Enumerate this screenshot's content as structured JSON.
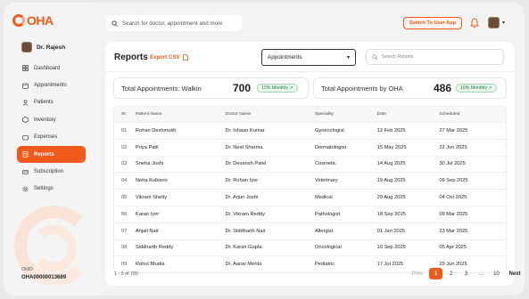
{
  "brand": {
    "logo_text": "OHA"
  },
  "user": {
    "name": "Dr. Rajesh"
  },
  "sidebar": {
    "items": [
      {
        "label": "Dashboard",
        "icon": "dashboard-icon"
      },
      {
        "label": "Appointments",
        "icon": "calendar-icon"
      },
      {
        "label": "Patients",
        "icon": "patients-icon"
      },
      {
        "label": "Inventory",
        "icon": "inventory-icon"
      },
      {
        "label": "Expenses",
        "icon": "wallet-icon"
      },
      {
        "label": "Reports",
        "icon": "reports-icon",
        "active": true
      },
      {
        "label": "Subscription",
        "icon": "subscription-icon"
      },
      {
        "label": "Settings",
        "icon": "gear-icon"
      }
    ],
    "ohid_label": "OHID",
    "ohid_value": "OHA00000013689"
  },
  "topbar": {
    "search_placeholder": "Search for doctor, appointment and more",
    "switch_label": "Switch To User App"
  },
  "page": {
    "title": "Reports",
    "export_label": "Export CSV",
    "select_value": "Appointments",
    "search_placeholder": "Search Reports"
  },
  "stats": [
    {
      "label": "Total Appointments: Walkin",
      "value": "700",
      "badge": "10% Monthly"
    },
    {
      "label": "Total Appointments by OHA",
      "value": "486",
      "badge": "10% Monthly"
    }
  ],
  "table": {
    "headers": [
      "Sr.",
      "Patient Name",
      "Doctor Name",
      "Speciality",
      "Date",
      "Scheduled"
    ],
    "rows": [
      [
        "01",
        "Rohan Deshmukh",
        "Dr. Ishaan Kumar",
        "Gynecologist",
        "12 Feb 2025",
        "27 Mar 2025"
      ],
      [
        "02",
        "Priya Patil",
        "Dr. Neel Sharma",
        "Dermatologist",
        "15 May 2025",
        "22 Jun 2025"
      ],
      [
        "03",
        "Sneha Joshi",
        "Dr. Devansh Patel",
        "Cosmetic",
        "14 Aug 2025",
        "30 Jul 2025"
      ],
      [
        "04",
        "Neha Kulkarni",
        "Dr. Rohan Iyer",
        "Veterinary",
        "19 Aug 2025",
        "09 Sep 2025"
      ],
      [
        "05",
        "Vikram Shetty",
        "Dr. Arjun Joshi",
        "Medical",
        "29 Aug 2025",
        "04 Oct 2025"
      ],
      [
        "06",
        "Karan Iyer",
        "Dr. Vikram Reddy",
        "Pathologist",
        "18 Sep 2025",
        "09 Mar 2025"
      ],
      [
        "07",
        "Anjali Nair",
        "Dr. Siddharth Nair",
        "Allergist",
        "01 Jan 2025",
        "23 Mar 2025"
      ],
      [
        "08",
        "Siddharth Reddy",
        "Dr. Karan Gupta",
        "Oncological",
        "10 Sep 2025",
        "05 Apr 2025"
      ],
      [
        "09",
        "Rahul Bhatia",
        "Dr. Aarav Mehta",
        "Pediatric",
        "17 Jul 2025",
        "29 Jun 2025"
      ]
    ]
  },
  "pagination": {
    "info": "1 - 9 of 700",
    "prev": "Prev",
    "pages": [
      "1",
      "2",
      "3",
      "...",
      "10"
    ],
    "current": "1",
    "next": "Next"
  },
  "colors": {
    "accent": "#f05a1a",
    "success": "#1a7f3c"
  }
}
